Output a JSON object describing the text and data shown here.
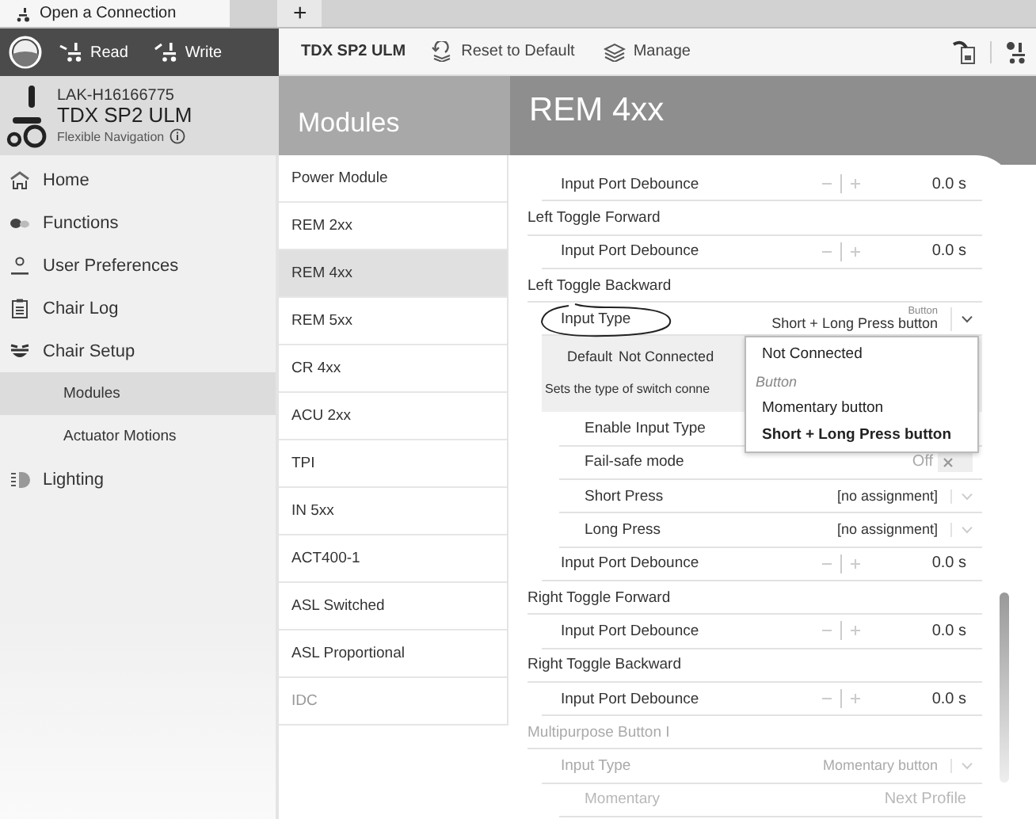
{
  "tabs": [
    {
      "label": "Open a Connection",
      "selected": true
    },
    {
      "label": "+",
      "selected": false
    }
  ],
  "toolbar": {
    "actions": [
      {
        "label": "Read",
        "kind": "read"
      },
      {
        "label": "Write",
        "kind": "write"
      }
    ],
    "device": "TDX SP2 ULM",
    "buttons": [
      {
        "label": "Reset to Default",
        "kind": "reset"
      },
      {
        "label": "Manage",
        "kind": "manage"
      }
    ]
  },
  "device": {
    "serial": "LAK-H16166775",
    "name": "TDX SP2 ULM",
    "mode": "Flexible Navigation"
  },
  "sidebar": {
    "items": [
      {
        "label": "Home",
        "kind": "home",
        "selected": false
      },
      {
        "label": "Functions",
        "kind": "functions",
        "selected": false
      },
      {
        "label": "User Preferences",
        "kind": "user",
        "selected": false
      },
      {
        "label": "Chair Log",
        "kind": "log",
        "selected": false
      },
      {
        "label": "Chair Setup",
        "kind": "setup",
        "selected": false,
        "children": [
          {
            "label": "Modules",
            "selected": true
          },
          {
            "label": "Actuator Motions",
            "selected": false
          }
        ]
      },
      {
        "label": "Lighting",
        "kind": "lighting",
        "selected": false
      }
    ]
  },
  "modules": {
    "title": "Modules",
    "items": [
      {
        "label": "Power Module",
        "selected": false,
        "disabled": false
      },
      {
        "label": "REM 2xx",
        "selected": false,
        "disabled": false
      },
      {
        "label": "REM 4xx",
        "selected": true,
        "disabled": false
      },
      {
        "label": "REM 5xx",
        "selected": false,
        "disabled": false
      },
      {
        "label": "CR 4xx",
        "selected": false,
        "disabled": false
      },
      {
        "label": "ACU 2xx",
        "selected": false,
        "disabled": false
      },
      {
        "label": "TPI",
        "selected": false,
        "disabled": false
      },
      {
        "label": "IN 5xx",
        "selected": false,
        "disabled": false
      },
      {
        "label": "ACT400-1",
        "selected": false,
        "disabled": false
      },
      {
        "label": "ASL Switched",
        "selected": false,
        "disabled": false
      },
      {
        "label": "ASL Proportional",
        "selected": false,
        "disabled": false
      },
      {
        "label": "IDC",
        "selected": false,
        "disabled": true
      }
    ]
  },
  "content": {
    "title": "REM 4xx",
    "sections": [
      {
        "disabled": false,
        "rows": [
          {
            "kind": "stepper",
            "label": "Input Port Debounce",
            "value": "0.0 s"
          }
        ]
      },
      {
        "title": "Left Toggle Forward",
        "disabled": false,
        "rows": [
          {
            "kind": "stepper",
            "label": "Input Port Debounce",
            "value": "0.0 s"
          }
        ]
      },
      {
        "title": "Left Toggle Backward",
        "disabled": false,
        "rows": [
          {
            "kind": "select",
            "label": "Input Type",
            "caption": "Button",
            "value": "Short + Long Press button",
            "highlighted": true,
            "expanded": true,
            "detail": {
              "default_label": "Default",
              "default_value": "Not Connected",
              "description": "Sets the type of switch conne"
            },
            "options": [
              {
                "kind": "option",
                "label": "Not Connected",
                "selected": false
              },
              {
                "kind": "header",
                "label": "Button"
              },
              {
                "kind": "option",
                "label": "Momentary button",
                "selected": false
              },
              {
                "kind": "option",
                "label": "Short + Long Press button",
                "selected": true
              }
            ],
            "children": [
              {
                "kind": "plain",
                "label": "Enable Input Type"
              },
              {
                "kind": "toggle",
                "label": "Fail-safe mode",
                "value": "Off",
                "on": false
              },
              {
                "kind": "select",
                "label": "Short Press",
                "value": "[no assignment]"
              },
              {
                "kind": "select",
                "label": "Long Press",
                "value": "[no assignment]"
              }
            ]
          },
          {
            "kind": "stepper",
            "label": "Input Port Debounce",
            "value": "0.0 s"
          }
        ]
      },
      {
        "title": "Right Toggle Forward",
        "disabled": false,
        "rows": [
          {
            "kind": "stepper",
            "label": "Input Port Debounce",
            "value": "0.0 s"
          }
        ]
      },
      {
        "title": "Right Toggle Backward",
        "disabled": false,
        "rows": [
          {
            "kind": "stepper",
            "label": "Input Port Debounce",
            "value": "0.0 s"
          }
        ]
      },
      {
        "title": "Multipurpose Button I",
        "disabled": true,
        "rows": [
          {
            "kind": "select",
            "label": "Input Type",
            "value": "Momentary button",
            "children": [
              {
                "kind": "plain",
                "label": "Momentary",
                "value": "Next Profile"
              }
            ]
          }
        ]
      }
    ]
  }
}
